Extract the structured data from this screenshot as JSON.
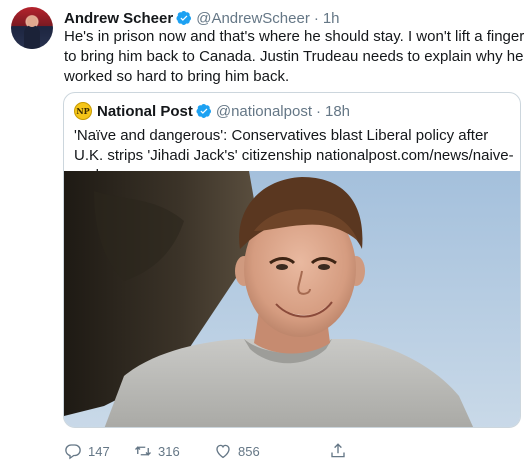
{
  "tweet": {
    "author_name": "Andrew Scheer",
    "handle": "@AndrewScheer",
    "separator": "·",
    "time": "1h",
    "text": "He's in prison now and that's where he should stay. I won't lift a finger to bring him back to Canada. Justin Trudeau needs to explain why he worked so hard to bring him back."
  },
  "quoted": {
    "logo_text": "NP",
    "author_name": "National Post",
    "handle": "@nationalpost",
    "separator": "·",
    "time": "18h",
    "text": "'Naïve and dangerous': Conservatives blast Liberal policy after U.K. strips 'Jihadi Jack's' citizenship nationalpost.com/news/naive-and..."
  },
  "actions": {
    "reply_count": "147",
    "retweet_count": "316",
    "like_count": "856"
  },
  "icons": {
    "verified": "verified-badge-icon",
    "reply": "reply-icon",
    "retweet": "retweet-icon",
    "like": "heart-icon",
    "share": "share-icon"
  },
  "colors": {
    "verified_blue": "#1da1f2",
    "muted_text": "#657786",
    "border": "#ccd6dd"
  }
}
